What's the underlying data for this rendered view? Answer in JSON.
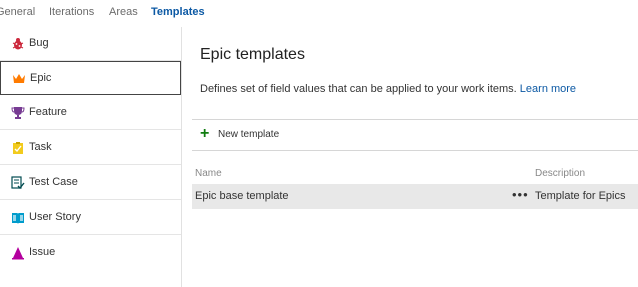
{
  "tabs": [
    {
      "label": "General",
      "active": false
    },
    {
      "label": "Iterations",
      "active": false
    },
    {
      "label": "Areas",
      "active": false
    },
    {
      "label": "Templates",
      "active": true
    }
  ],
  "sidebar": {
    "items": [
      {
        "label": "Bug",
        "icon": "bug-icon",
        "color": "#cc293d"
      },
      {
        "label": "Epic",
        "icon": "crown-icon",
        "color": "#ff7b00",
        "selected": true
      },
      {
        "label": "Feature",
        "icon": "trophy-icon",
        "color": "#773b93"
      },
      {
        "label": "Task",
        "icon": "clipboard-icon",
        "color": "#f2cb1d"
      },
      {
        "label": "Test Case",
        "icon": "test-case-icon",
        "color": "#004b50"
      },
      {
        "label": "User Story",
        "icon": "book-icon",
        "color": "#009ccc"
      },
      {
        "label": "Issue",
        "icon": "issue-icon",
        "color": "#b4009e"
      }
    ]
  },
  "main": {
    "title": "Epic templates",
    "description": "Defines set of field values that can be applied to your work items.",
    "learn_more": "Learn more",
    "new_template_label": "New template",
    "columns": {
      "name": "Name",
      "description": "Description"
    },
    "rows": [
      {
        "name": "Epic base template",
        "more": "•••",
        "description": "Template for Epics"
      }
    ]
  },
  "colors": {
    "accent": "#0c59a4",
    "add": "#107c10",
    "row_bg": "#e8e8e8"
  }
}
